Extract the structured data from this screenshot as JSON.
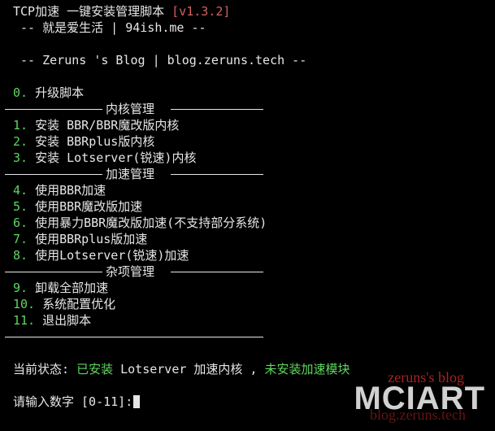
{
  "header": {
    "title": "TCP加速 一键安装管理脚本 ",
    "version": "[v1.3.2]",
    "line2": " -- 就是爱生活 | 94ish.me --",
    "line3": " -- Zeruns 's Blog | blog.zeruns.tech --"
  },
  "menu": {
    "upgrade": {
      "num": "0.",
      "label": " 升级脚本"
    },
    "sections": [
      {
        "title": "内核管理"
      },
      {
        "title": "加速管理"
      },
      {
        "title": "杂项管理"
      }
    ],
    "kernel_items": [
      {
        "num": "1.",
        "label": " 安装 BBR/BBR魔改版内核"
      },
      {
        "num": "2.",
        "label": " 安装 BBRplus版内核"
      },
      {
        "num": "3.",
        "label": " 安装 Lotserver(锐速)内核"
      }
    ],
    "accel_items": [
      {
        "num": "4.",
        "label": " 使用BBR加速"
      },
      {
        "num": "5.",
        "label": " 使用BBR魔改版加速"
      },
      {
        "num": "6.",
        "label": " 使用暴力BBR魔改版加速(不支持部分系统)"
      },
      {
        "num": "7.",
        "label": " 使用BBRplus版加速"
      },
      {
        "num": "8.",
        "label": " 使用Lotserver(锐速)加速"
      }
    ],
    "misc_items": [
      {
        "num": "9.",
        "label": " 卸载全部加速"
      },
      {
        "num": "10.",
        "label": " 系统配置优化"
      },
      {
        "num": "11.",
        "label": " 退出脚本"
      }
    ]
  },
  "status": {
    "label": "当前状态: ",
    "installed": "已安装",
    "detail": " Lotserver 加速内核 , ",
    "module": "未安装加速模块"
  },
  "prompt": {
    "text": "请输入数字 [0-11]:"
  },
  "watermark": {
    "top": "zeruns's blog",
    "main": "MCIART",
    "bottom": "blog.zeruns.tech"
  },
  "colors": {
    "background": "#000000",
    "foreground": "#e6e6e6",
    "accent_green": "#5fd75f",
    "accent_red": "#d75f5f"
  }
}
